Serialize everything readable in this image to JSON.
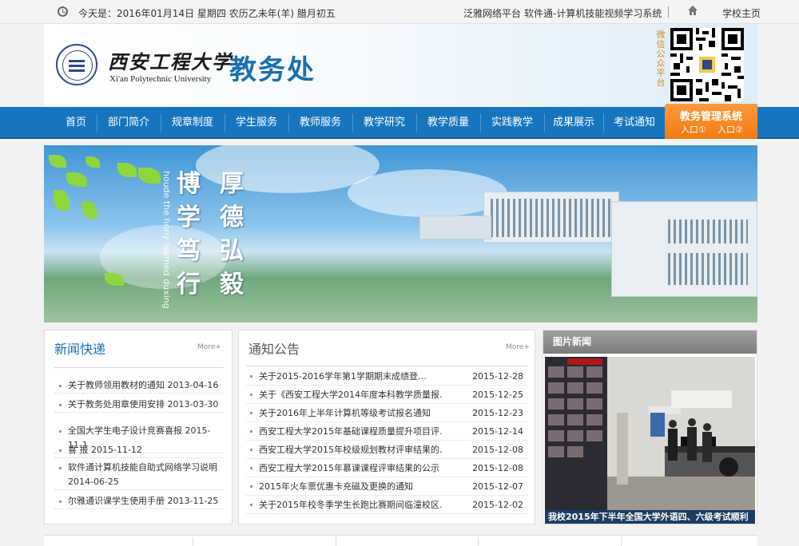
{
  "topbar": {
    "date": "今天是：2016年01月14日   星期四   农历乙未年(羊)   腊月初五",
    "links": [
      "泛雅网络平台",
      "软件通-计算机技能视频学习系统"
    ],
    "home_label": "学校主页"
  },
  "header": {
    "school_cn": "西安工程大学",
    "school_en": "Xi'an Polytechnic University",
    "dept": "教务处",
    "wechat": "微信公众平台"
  },
  "nav": {
    "items": [
      "首页",
      "部门简介",
      "规章制度",
      "学生服务",
      "教师服务",
      "教学研究",
      "教学质量",
      "实践教学",
      "成果展示",
      "考试通知"
    ],
    "system_title": "教务管理系统",
    "entry1": "入口①",
    "entry2": "入口②"
  },
  "banner": {
    "motto_col1": [
      "博",
      "学",
      "笃",
      "行"
    ],
    "motto_col2": [
      "厚",
      "德",
      "弘",
      "毅"
    ],
    "motto_en": "houde the hony learned duxing"
  },
  "news": {
    "title": "新闻快递",
    "more": "More+",
    "items": [
      "关于教师领用教材的通知 2013-04-16",
      "关于教务处用章使用安排 2013-03-30",
      "全国大学生电子设计竞赛喜报 2015-11-1",
      "喜 报 2015-11-12",
      "软件通计算机技能自助式网络学习说明 2014-06-25",
      "尔雅通识课学生使用手册 2013-11-25"
    ]
  },
  "notices": {
    "title": "通知公告",
    "more": "More+",
    "items": [
      {
        "title": "关于2015-2016学年第1学期期末成绩登…",
        "date": "2015-12-28"
      },
      {
        "title": "关于《西安工程大学2014年度本科教学质量报…",
        "date": "2015-12-25"
      },
      {
        "title": "关于2016年上半年计算机等级考试报名通知",
        "date": "2015-12-23"
      },
      {
        "title": "西安工程大学2015年基础课程质量提升项目评…",
        "date": "2015-12-14"
      },
      {
        "title": "西安工程大学2015年校级规划教材评审结果的…",
        "date": "2015-12-08"
      },
      {
        "title": "西安工程大学2015年慕课课程评审结果的公示",
        "date": "2015-12-08"
      },
      {
        "title": "2015年火车票优惠卡充磁及更换的通知",
        "date": "2015-12-07"
      },
      {
        "title": "关于2015年校冬季学生长跑比赛期间临潼校区…",
        "date": "2015-12-02"
      }
    ]
  },
  "photo_news": {
    "title": "图片新闻",
    "caption": "我校2015年下半年全国大学外语四、六级考试顺利"
  }
}
